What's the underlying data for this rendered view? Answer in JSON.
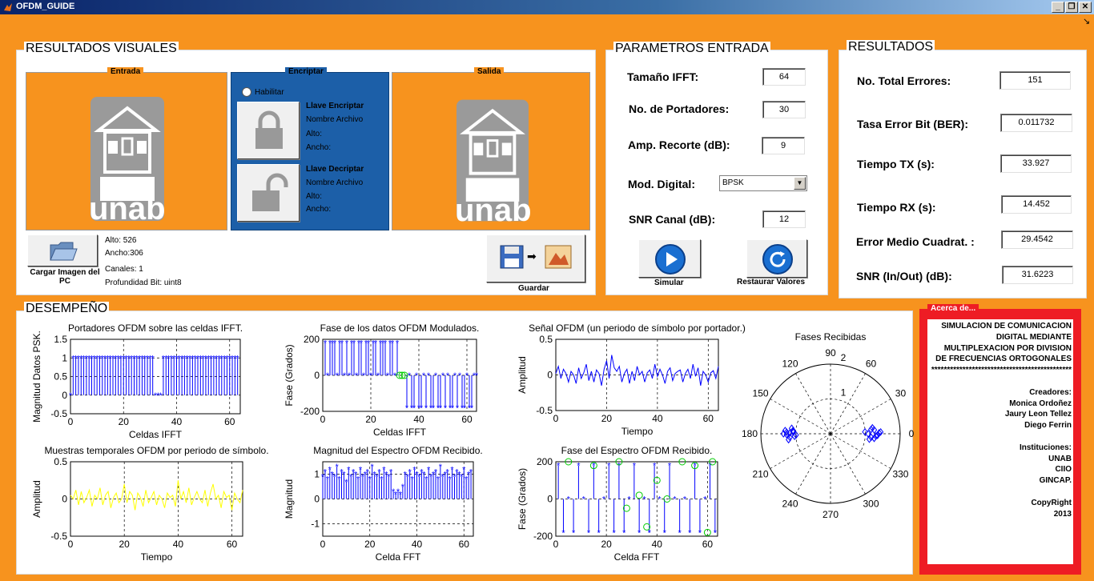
{
  "window": {
    "title": "OFDM_GUIDE",
    "buttons": [
      "_",
      "❐",
      "✕"
    ],
    "corner_arrow": "↘"
  },
  "visual": {
    "title": "RESULTADOS VISUALES",
    "entrada_tag": "Entrada",
    "encriptar_tag": "Encriptar",
    "salida_tag": "Salida",
    "logo_text": "unab",
    "habilitar": "Habilitar",
    "key_enc": {
      "title": "Llave Encriptar",
      "file": "Nombre Archivo",
      "alto": "Alto:",
      "ancho": "Ancho:"
    },
    "key_dec": {
      "title": "Llave Decriptar",
      "file": "Nombre Archivo",
      "alto": "Alto:",
      "ancho": "Ancho:"
    },
    "cargar_label": "Cargar Imagen del PC",
    "info": {
      "alto": "Alto: 526",
      "ancho": "Ancho:306",
      "canales": "Canales: 1",
      "profundidad": "Profundidad Bit: uint8"
    },
    "guardar_label": "Guardar"
  },
  "params": {
    "title": "PARAMETROS ENTRADA",
    "fields": [
      {
        "label": "Tamaño IFFT:",
        "value": "64"
      },
      {
        "label": "No. de Portadores:",
        "value": "30"
      },
      {
        "label": "Amp. Recorte (dB):",
        "value": "9"
      },
      {
        "label": "Mod. Digital:",
        "value": "BPSK"
      },
      {
        "label": "SNR Canal (dB):",
        "value": "12"
      }
    ],
    "simular": "Simular",
    "restaurar": "Restaurar Valores"
  },
  "results": {
    "title": "RESULTADOS",
    "fields": [
      {
        "label": "No. Total Errores:",
        "value": "151"
      },
      {
        "label": "Tasa Error Bit (BER):",
        "value": "0.011732"
      },
      {
        "label": "Tiempo TX (s):",
        "value": "33.927"
      },
      {
        "label": "Tiempo RX (s):",
        "value": "14.452"
      },
      {
        "label": "Error Medio Cuadrat. :",
        "value": "29.4542"
      },
      {
        "label": "SNR (In/Out) (dB):",
        "value": "31.6223"
      }
    ]
  },
  "performance": {
    "title": "DESEMPEÑO"
  },
  "about": {
    "tag": "Acerca de...",
    "lines": [
      "SIMULACION DE COMUNICACION",
      "DIGITAL  MEDIANTE",
      "MULTIPLEXACION POR  DIVISION",
      "DE FRECUENCIAS ORTOGONALES",
      "*********************************************",
      "",
      "Creadores:",
      "Monica Ordoñez",
      "Jaury Leon Tellez",
      "Diego Ferrin",
      "",
      "Instituciones:",
      "UNAB",
      "CIIO",
      "GINCAP.",
      "",
      "CopyRight",
      "2013"
    ]
  },
  "colors": {
    "orange": "#f7931e",
    "blue_panel": "#1c5fa8",
    "blue_line": "#0000ff",
    "green": "#00cc00",
    "yellow": "#ffff00",
    "red": "#ee1c24"
  },
  "chart_data": [
    {
      "type": "line",
      "title": "Portadores OFDM sobre las celdas IFFT.",
      "xlabel": "Celdas IFFT",
      "ylabel": "Magnitud Datos PSK.",
      "xlim": [
        0,
        64
      ],
      "ylim": [
        -0.5,
        1.5
      ],
      "xticks": [
        "0",
        "20",
        "40",
        "60"
      ],
      "yticks": [
        "-0.5",
        "0",
        "0.5",
        "1",
        "1.5"
      ],
      "grid": true,
      "series": [
        {
          "style": "stem",
          "color": "#0000ff",
          "x": [
            0,
            1,
            2,
            3,
            4,
            5,
            6,
            7,
            8,
            9,
            10,
            11,
            12,
            13,
            14,
            15,
            16,
            17,
            18,
            19,
            20,
            21,
            22,
            23,
            24,
            25,
            26,
            27,
            28,
            29,
            30,
            31,
            32,
            33,
            34,
            35,
            36,
            37,
            38,
            39,
            40,
            41,
            42,
            43,
            44,
            45,
            46,
            47,
            48,
            49,
            50,
            51,
            52,
            53,
            54,
            55,
            56,
            57,
            58,
            59,
            60,
            61,
            62,
            63
          ],
          "y": [
            0,
            1,
            1,
            1,
            1,
            1,
            1,
            1,
            1,
            1,
            1,
            1,
            1,
            1,
            1,
            1,
            1,
            1,
            1,
            1,
            1,
            1,
            1,
            1,
            1,
            1,
            1,
            1,
            1,
            1,
            1,
            1,
            0,
            0,
            0,
            1,
            1,
            1,
            1,
            1,
            1,
            1,
            1,
            1,
            1,
            1,
            1,
            1,
            1,
            1,
            1,
            1,
            1,
            1,
            1,
            1,
            1,
            1,
            1,
            1,
            1,
            1,
            1,
            1
          ]
        }
      ]
    },
    {
      "type": "line",
      "title": "Fase de los datos OFDM Modulados.",
      "xlabel": "Celdas IFFT",
      "ylabel": "Fase (Grados)",
      "xlim": [
        0,
        64
      ],
      "ylim": [
        -200,
        200
      ],
      "xticks": [
        "0",
        "20",
        "40",
        "60"
      ],
      "yticks": [
        "-200",
        "0",
        "200"
      ],
      "grid": true,
      "series": [
        {
          "style": "stem",
          "color": "#0000ff",
          "x": [
            1,
            2,
            3,
            4,
            5,
            6,
            7,
            8,
            9,
            10,
            11,
            12,
            13,
            14,
            15,
            16,
            17,
            18,
            19,
            20,
            21,
            22,
            23,
            24,
            25,
            26,
            27,
            28,
            29,
            30,
            31,
            35,
            36,
            37,
            38,
            39,
            40,
            41,
            42,
            43,
            44,
            45,
            46,
            47,
            48,
            49,
            50,
            51,
            52,
            53,
            54,
            55,
            56,
            57,
            58,
            59,
            60,
            61,
            62,
            63,
            64
          ],
          "y": [
            180,
            0,
            180,
            180,
            180,
            0,
            180,
            180,
            0,
            180,
            0,
            180,
            180,
            0,
            180,
            180,
            0,
            180,
            180,
            0,
            180,
            180,
            0,
            180,
            180,
            180,
            0,
            180,
            180,
            0,
            180,
            -180,
            0,
            -180,
            -180,
            0,
            -180,
            -180,
            0,
            -180,
            0,
            -180,
            -180,
            0,
            -180,
            -180,
            0,
            -180,
            0,
            -180,
            -180,
            0,
            -180,
            0,
            -180,
            -180,
            0,
            -180,
            -180,
            0,
            0
          ]
        },
        {
          "style": "points",
          "color": "#00cc00",
          "x": [
            32,
            33,
            34
          ],
          "y": [
            0,
            0,
            0
          ]
        }
      ]
    },
    {
      "type": "line",
      "title": "Señal OFDM (un periodo de símbolo por portador.)",
      "xlabel": "Tiempo",
      "ylabel": "Amplitud",
      "xlim": [
        0,
        64
      ],
      "ylim": [
        -0.5,
        0.5
      ],
      "xticks": [
        "0",
        "20",
        "40",
        "60"
      ],
      "yticks": [
        "-0.5",
        "0",
        "0.5"
      ],
      "grid": true,
      "series": [
        {
          "style": "line",
          "color": "#0000ff",
          "x": [
            0,
            1,
            2,
            3,
            4,
            5,
            6,
            7,
            8,
            9,
            10,
            11,
            12,
            13,
            14,
            15,
            16,
            17,
            18,
            19,
            20,
            21,
            22,
            23,
            24,
            25,
            26,
            27,
            28,
            29,
            30,
            31,
            32,
            33,
            34,
            35,
            36,
            37,
            38,
            39,
            40,
            41,
            42,
            43,
            44,
            45,
            46,
            47,
            48,
            49,
            50,
            51,
            52,
            53,
            54,
            55,
            56,
            57,
            58,
            59,
            60,
            61,
            62,
            63,
            64
          ],
          "y": [
            0.02,
            0.12,
            -0.05,
            0.08,
            0.02,
            -0.1,
            0.05,
            0.0,
            -0.12,
            0.1,
            -0.05,
            0.03,
            0.15,
            -0.08,
            0.05,
            -0.1,
            0.07,
            0.02,
            -0.15,
            0.08,
            0.2,
            -0.05,
            0.28,
            0.1,
            0.05,
            0.12,
            -0.1,
            0.02,
            0.08,
            -0.12,
            0.05,
            -0.08,
            0.12,
            0.0,
            0.05,
            -0.1,
            0.03,
            0.07,
            -0.05,
            0.15,
            -0.02,
            0.08,
            0.0,
            -0.12,
            0.05,
            0.1,
            -0.08,
            0.02,
            0.05,
            0.07,
            -0.1,
            0.02,
            0.08,
            -0.05,
            0.15,
            -0.02,
            0.1,
            -0.15,
            0.05,
            0.0,
            -0.1,
            0.03,
            0.06,
            -0.05,
            0.12
          ]
        }
      ]
    },
    {
      "type": "line",
      "title": "Muestras temporales OFDM por periodo de símbolo.",
      "xlabel": "Tiempo",
      "ylabel": "Amplitud",
      "xlim": [
        0,
        64
      ],
      "ylim": [
        -0.5,
        0.5
      ],
      "xticks": [
        "0",
        "20",
        "40",
        "60"
      ],
      "yticks": [
        "-0.5",
        "0",
        "0.5"
      ],
      "grid": true,
      "series": [
        {
          "style": "line",
          "color": "#ffff00",
          "x": [
            0,
            1,
            2,
            3,
            4,
            5,
            6,
            7,
            8,
            9,
            10,
            11,
            12,
            13,
            14,
            15,
            16,
            17,
            18,
            19,
            20,
            21,
            22,
            23,
            24,
            25,
            26,
            27,
            28,
            29,
            30,
            31,
            32,
            33,
            34,
            35,
            36,
            37,
            38,
            39,
            40,
            41,
            42,
            43,
            44,
            45,
            46,
            47,
            48,
            49,
            50,
            51,
            52,
            53,
            54,
            55,
            56,
            57,
            58,
            59,
            60,
            61,
            62,
            63,
            64
          ],
          "y": [
            0.05,
            0.0,
            0.12,
            -0.08,
            0.1,
            -0.05,
            0.02,
            0.12,
            -0.1,
            0.05,
            0.0,
            0.15,
            -0.08,
            0.05,
            0.1,
            -0.12,
            0.02,
            0.08,
            -0.05,
            0.0,
            0.2,
            -0.05,
            0.1,
            0.05,
            -0.15,
            0.08,
            0.02,
            -0.1,
            0.12,
            -0.05,
            0.02,
            0.1,
            -0.08,
            0.05,
            0.0,
            -0.12,
            0.08,
            0.02,
            0.05,
            -0.1,
            0.25,
            0.0,
            0.1,
            -0.05,
            0.15,
            -0.08,
            0.02,
            0.1,
            0.0,
            -0.05,
            0.12,
            -0.1,
            0.08,
            0.2,
            0.0,
            0.05,
            -0.12,
            0.1,
            0.02,
            0.05,
            -0.15,
            0.08,
            0.0,
            -0.05,
            0.12
          ]
        }
      ]
    },
    {
      "type": "line",
      "title": "Magnitud del Espectro OFDM Recibido.",
      "xlabel": "Celda FFT",
      "ylabel": "Magnitud",
      "xlim": [
        0,
        64
      ],
      "ylim": [
        -1.5,
        1.5
      ],
      "xticks": [
        "0",
        "20",
        "40",
        "60"
      ],
      "yticks": [
        "-1",
        "0",
        "1"
      ],
      "grid": true,
      "series": [
        {
          "style": "stem",
          "color": "#0000ff",
          "x": [
            0,
            1,
            2,
            3,
            4,
            5,
            6,
            7,
            8,
            9,
            10,
            11,
            12,
            13,
            14,
            15,
            16,
            17,
            18,
            19,
            20,
            21,
            22,
            23,
            24,
            25,
            26,
            27,
            28,
            29,
            30,
            31,
            32,
            33,
            34,
            35,
            36,
            37,
            38,
            39,
            40,
            41,
            42,
            43,
            44,
            45,
            46,
            47,
            48,
            49,
            50,
            51,
            52,
            53,
            54,
            55,
            56,
            57,
            58,
            59,
            60,
            61,
            62,
            63
          ],
          "y": [
            0.9,
            1.1,
            0.8,
            1.2,
            1.0,
            0.9,
            1.3,
            0.8,
            1.1,
            1.0,
            0.7,
            1.2,
            0.9,
            1.1,
            1.0,
            0.8,
            1.2,
            0.9,
            1.0,
            1.1,
            0.8,
            1.3,
            1.0,
            0.9,
            1.1,
            0.8,
            1.2,
            1.0,
            0.9,
            1.1,
            0.3,
            0.2,
            0.3,
            0.2,
            0.5,
            1.0,
            0.9,
            1.1,
            0.8,
            1.2,
            1.0,
            0.9,
            1.1,
            1.0,
            0.8,
            1.2,
            0.9,
            1.0,
            1.1,
            0.8,
            1.3,
            0.9,
            1.0,
            1.1,
            0.8,
            1.2,
            0.9,
            1.1,
            1.0,
            0.9,
            1.2,
            0.8,
            1.0,
            1.1
          ]
        }
      ]
    },
    {
      "type": "line",
      "title": "Fase del Espectro OFDM Recibido.",
      "xlabel": "Celda FFT",
      "ylabel": "Fase (Grados)",
      "xlim": [
        0,
        64
      ],
      "ylim": [
        -200,
        200
      ],
      "xticks": [
        "0",
        "20",
        "40",
        "60"
      ],
      "yticks": [
        "-200",
        "0",
        "200"
      ],
      "grid": true,
      "series": [
        {
          "style": "stem",
          "color": "#0000ff",
          "x": [
            1,
            3,
            5,
            7,
            9,
            11,
            13,
            15,
            17,
            19,
            21,
            23,
            25,
            27,
            29,
            31,
            33,
            35,
            37,
            39,
            41,
            43,
            45,
            47,
            49,
            51,
            53,
            55,
            57,
            59,
            61,
            63
          ],
          "y": [
            180,
            -180,
            0,
            -180,
            180,
            0,
            -180,
            180,
            -180,
            0,
            180,
            -180,
            180,
            -180,
            0,
            180,
            -180,
            0,
            -180,
            180,
            0,
            -180,
            180,
            0,
            -180,
            0,
            -180,
            180,
            -180,
            0,
            180,
            -180
          ]
        },
        {
          "style": "points",
          "color": "#00cc00",
          "x": [
            5,
            15,
            25,
            28,
            33,
            36,
            40,
            44,
            50,
            55,
            60,
            62
          ],
          "y": [
            200,
            180,
            200,
            -50,
            20,
            -150,
            100,
            0,
            200,
            180,
            -180,
            200
          ]
        }
      ]
    },
    {
      "type": "scatter",
      "title": "Fases Recibidas",
      "polar": true,
      "rlim": [
        0,
        2
      ],
      "angle_labels": [
        "90",
        "60",
        "30",
        "0",
        "330",
        "300",
        "270",
        "240",
        "210",
        "180",
        "150",
        "120"
      ],
      "r_labels": [
        "1",
        "2"
      ],
      "series": [
        {
          "marker": "diamond",
          "color": "#0000ff",
          "angle_deg": [
            175,
            178,
            182,
            185,
            180,
            172,
            188,
            176,
            184,
            179,
            181,
            177,
            0,
            5,
            355,
            358,
            3,
            8,
            352,
            2,
            357,
            6,
            354,
            1
          ],
          "r": [
            1.2,
            1.4,
            1.1,
            1.3,
            1.5,
            1.25,
            1.35,
            1.45,
            1.15,
            1.3,
            1.4,
            1.2,
            1.2,
            1.4,
            1.3,
            1.5,
            1.1,
            1.35,
            1.25,
            1.6,
            1.45,
            1.3,
            1.4,
            1.55
          ]
        }
      ]
    }
  ]
}
